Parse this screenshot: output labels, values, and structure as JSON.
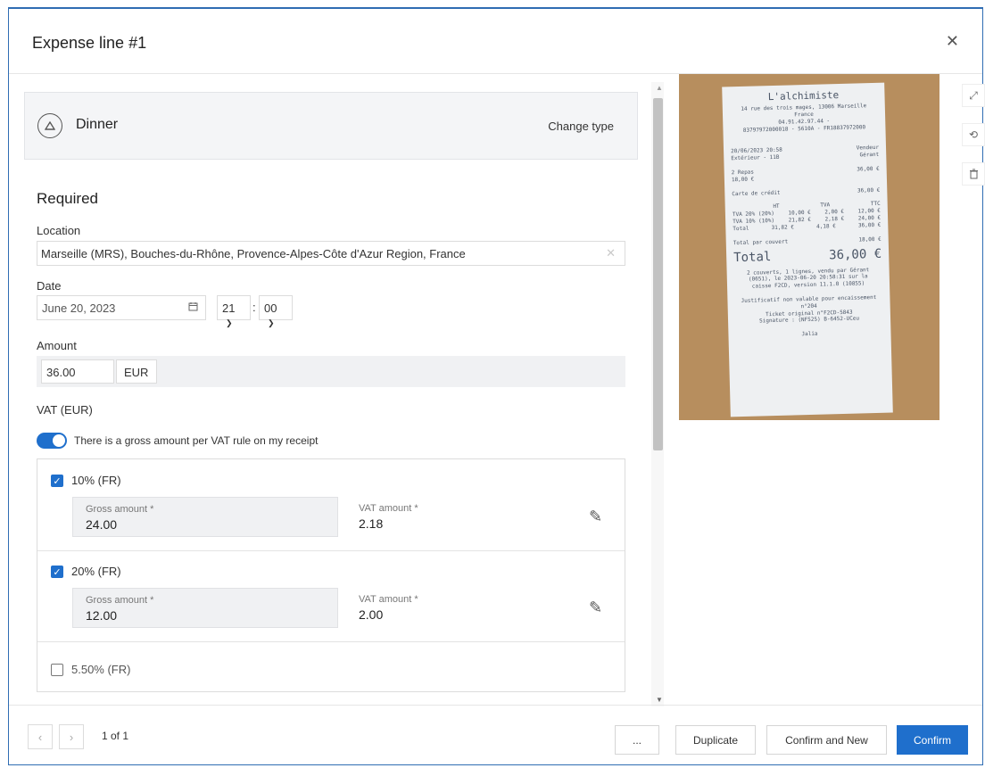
{
  "dialog": {
    "title": "Expense line #1",
    "close_icon": "close-icon"
  },
  "expense_type": {
    "label": "Dinner",
    "change_label": "Change type",
    "icon": "food-icon"
  },
  "form": {
    "section_title": "Required",
    "location": {
      "label": "Location",
      "value": "Marseille (MRS), Bouches-du-Rhône, Provence-Alpes-Côte d'Azur Region, France"
    },
    "date": {
      "label": "Date",
      "value": "June 20, 2023",
      "hour": "21",
      "minute": "00"
    },
    "amount": {
      "label": "Amount",
      "value": "36.00",
      "currency": "EUR"
    },
    "vat": {
      "label": "VAT (EUR)",
      "toggle_label": "There is a gross amount per VAT rule on my receipt",
      "toggle_on": true,
      "rules": [
        {
          "rate": "10% (FR)",
          "checked": true,
          "gross_label": "Gross amount *",
          "gross_value": "24.00",
          "vat_label": "VAT amount *",
          "vat_value": "2.18"
        },
        {
          "rate": "20% (FR)",
          "checked": true,
          "gross_label": "Gross amount *",
          "gross_value": "12.00",
          "vat_label": "VAT amount *",
          "vat_value": "2.00"
        },
        {
          "rate": "5.50% (FR)",
          "checked": false
        }
      ]
    }
  },
  "receipt": {
    "title": "L'alchimiste",
    "address": [
      "14 rue des trois mages, 13006 Marseille",
      "France",
      "04.91.42.97.44 -",
      "83797972000018 - 5610A - FR18837972000"
    ],
    "date_line": [
      "20/06/2023 20:58",
      "Vendeur"
    ],
    "place_line": [
      "Extérieur - 11B",
      "Gérant"
    ],
    "item_line": [
      "2 Repas",
      "36,00 €"
    ],
    "item_unit": "18,00 €",
    "payment_line": [
      "Carte de crédit",
      "36,00 €"
    ],
    "tax_header": [
      "HT",
      "TVA",
      "TTC"
    ],
    "tax_rows": [
      [
        "TVA 20% (20%)",
        "10,00 €",
        "2,00 €",
        "12,00 €"
      ],
      [
        "TVA 10% (10%)",
        "21,82 €",
        "2,18 €",
        "24,00 €"
      ],
      [
        "Total",
        "31,82 €",
        "4,18 €",
        "36,00 €"
      ]
    ],
    "per_cover": [
      "Total par couvert",
      "18,00 €"
    ],
    "total_label": "Total",
    "total_value": "36,00 €",
    "footer_lines": [
      "2 couverts, 1 lignes, vendu par Gérant",
      "(0651), le 2023-06-20 20:58:31 sur la",
      "caisse F2CD, version 11.1.0 (10855)",
      "Justificatif non valable pour encaissement",
      "n°204",
      "Ticket original n°F2CD-5843",
      "Signature : (NF525) B-6452-UCeu",
      "Jalia"
    ]
  },
  "side_tools": {
    "expand": "expand-icon",
    "rotate": "rotate-icon",
    "delete": "trash-icon"
  },
  "footer": {
    "page_text": "1 of 1",
    "more_label": "...",
    "duplicate_label": "Duplicate",
    "confirm_new_label": "Confirm and New",
    "confirm_label": "Confirm"
  },
  "colors": {
    "accent": "#1f6fcc",
    "frame": "#2f6db3",
    "receipt_bg": "#b78e5e"
  }
}
